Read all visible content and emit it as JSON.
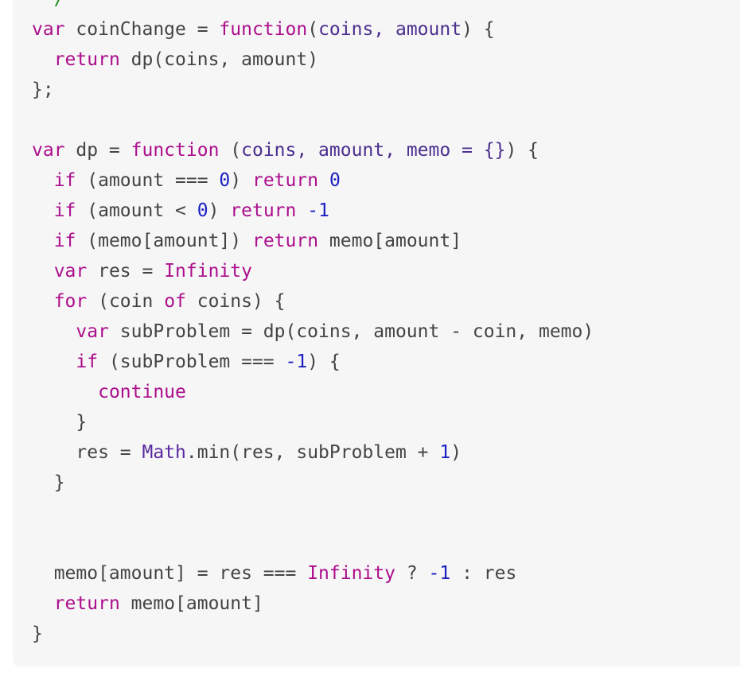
{
  "code": {
    "lines": [
      [
        {
          "t": " */",
          "c": "cm"
        }
      ],
      [
        {
          "t": "var",
          "c": "kw"
        },
        {
          "t": " coinChange = ",
          "c": ""
        },
        {
          "t": "function",
          "c": "fn"
        },
        {
          "t": "(",
          "c": ""
        },
        {
          "t": "coins, amount",
          "c": "prm"
        },
        {
          "t": ") {",
          "c": ""
        }
      ],
      [
        {
          "t": "  ",
          "c": ""
        },
        {
          "t": "return",
          "c": "kw"
        },
        {
          "t": " dp(coins, amount)",
          "c": ""
        }
      ],
      [
        {
          "t": "};",
          "c": ""
        }
      ],
      [],
      [
        {
          "t": "var",
          "c": "kw"
        },
        {
          "t": " dp = ",
          "c": ""
        },
        {
          "t": "function",
          "c": "fn"
        },
        {
          "t": " (",
          "c": ""
        },
        {
          "t": "coins, amount, memo = {}",
          "c": "prm"
        },
        {
          "t": ") {",
          "c": ""
        }
      ],
      [
        {
          "t": "  ",
          "c": ""
        },
        {
          "t": "if",
          "c": "kw"
        },
        {
          "t": " (amount === ",
          "c": ""
        },
        {
          "t": "0",
          "c": "num"
        },
        {
          "t": ") ",
          "c": ""
        },
        {
          "t": "return",
          "c": "kw"
        },
        {
          "t": " ",
          "c": ""
        },
        {
          "t": "0",
          "c": "num"
        }
      ],
      [
        {
          "t": "  ",
          "c": ""
        },
        {
          "t": "if",
          "c": "kw"
        },
        {
          "t": " (amount < ",
          "c": ""
        },
        {
          "t": "0",
          "c": "num"
        },
        {
          "t": ") ",
          "c": ""
        },
        {
          "t": "return",
          "c": "kw"
        },
        {
          "t": " ",
          "c": ""
        },
        {
          "t": "-1",
          "c": "num"
        }
      ],
      [
        {
          "t": "  ",
          "c": ""
        },
        {
          "t": "if",
          "c": "kw"
        },
        {
          "t": " (memo[amount]) ",
          "c": ""
        },
        {
          "t": "return",
          "c": "kw"
        },
        {
          "t": " memo[amount]",
          "c": ""
        }
      ],
      [
        {
          "t": "  ",
          "c": ""
        },
        {
          "t": "var",
          "c": "kw"
        },
        {
          "t": " res = ",
          "c": ""
        },
        {
          "t": "Infinity",
          "c": "kw"
        }
      ],
      [
        {
          "t": "  ",
          "c": ""
        },
        {
          "t": "for",
          "c": "kw"
        },
        {
          "t": " (coin ",
          "c": ""
        },
        {
          "t": "of",
          "c": "kw"
        },
        {
          "t": " coins) {",
          "c": ""
        }
      ],
      [
        {
          "t": "    ",
          "c": ""
        },
        {
          "t": "var",
          "c": "kw"
        },
        {
          "t": " subProblem = dp(coins, amount - coin, memo)",
          "c": ""
        }
      ],
      [
        {
          "t": "    ",
          "c": ""
        },
        {
          "t": "if",
          "c": "kw"
        },
        {
          "t": " (subProblem === ",
          "c": ""
        },
        {
          "t": "-1",
          "c": "num"
        },
        {
          "t": ") {",
          "c": ""
        }
      ],
      [
        {
          "t": "      ",
          "c": ""
        },
        {
          "t": "continue",
          "c": "kw"
        }
      ],
      [
        {
          "t": "    }",
          "c": ""
        }
      ],
      [
        {
          "t": "    res = ",
          "c": ""
        },
        {
          "t": "Math",
          "c": "bi"
        },
        {
          "t": ".min(res, subProblem + ",
          "c": ""
        },
        {
          "t": "1",
          "c": "num"
        },
        {
          "t": ")",
          "c": ""
        }
      ],
      [
        {
          "t": "  }",
          "c": ""
        }
      ],
      [],
      [],
      [
        {
          "t": "  memo[amount] = res === ",
          "c": ""
        },
        {
          "t": "Infinity",
          "c": "kw"
        },
        {
          "t": " ? ",
          "c": ""
        },
        {
          "t": "-1",
          "c": "num"
        },
        {
          "t": " : res",
          "c": ""
        }
      ],
      [
        {
          "t": "  ",
          "c": ""
        },
        {
          "t": "return",
          "c": "kw"
        },
        {
          "t": " memo[amount]",
          "c": ""
        }
      ],
      [
        {
          "t": "}",
          "c": ""
        }
      ]
    ]
  }
}
